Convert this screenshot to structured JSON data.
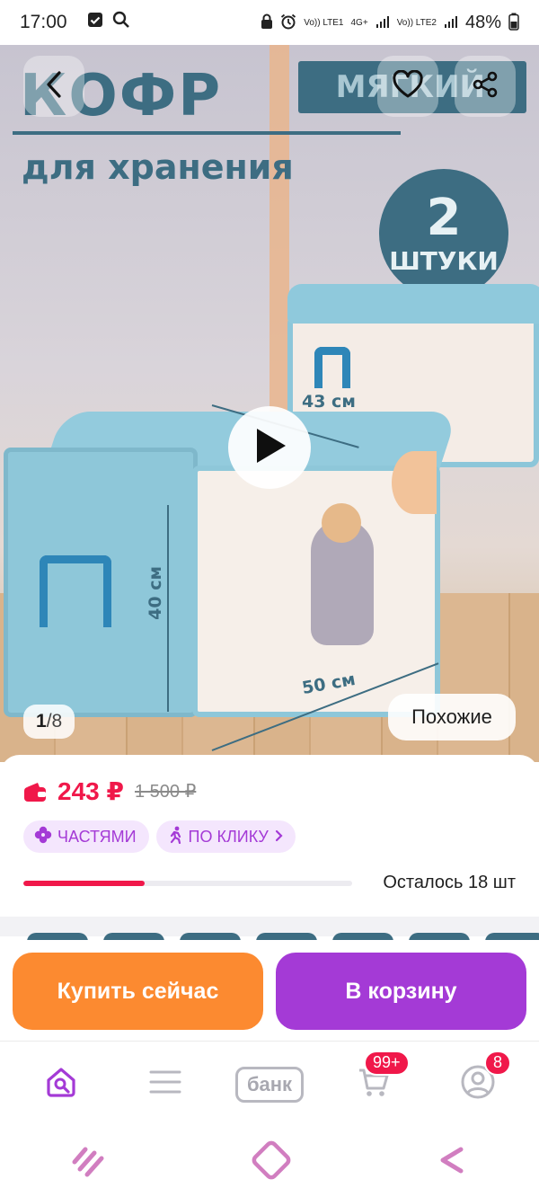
{
  "status_bar": {
    "time": "17:00",
    "network_1": "Vo)) LTE1",
    "network_4g": "4G+",
    "network_2": "Vo)) LTE2",
    "battery": "48%"
  },
  "product_image": {
    "promo_title": "КОФР",
    "promo_badge": "МЯГКИЙ",
    "promo_subtitle": "для хранения",
    "count_number": "2",
    "count_unit": "ШТУКИ",
    "dim_depth": "43 см",
    "dim_height": "40 см",
    "dim_width": "50 см",
    "page_current": "1",
    "page_separator": "/",
    "page_total": "8",
    "similar_label": "Похожие"
  },
  "pricing": {
    "price": "243 ₽",
    "old_price": "1 500 ₽",
    "chip_installments": "ЧАСТЯМИ",
    "chip_one_click": "ПО КЛИКУ",
    "stock_text": "Осталось 18 шт",
    "stock_fraction": 0.37
  },
  "actions": {
    "buy_now": "Купить сейчас",
    "add_to_cart": "В корзину"
  },
  "tabbar": {
    "bank_label": "банк",
    "cart_badge": "99+",
    "profile_badge": "8"
  },
  "colors": {
    "accent_pink": "#f0184a",
    "accent_purple": "#a43ad6",
    "accent_orange": "#fc8a30"
  }
}
